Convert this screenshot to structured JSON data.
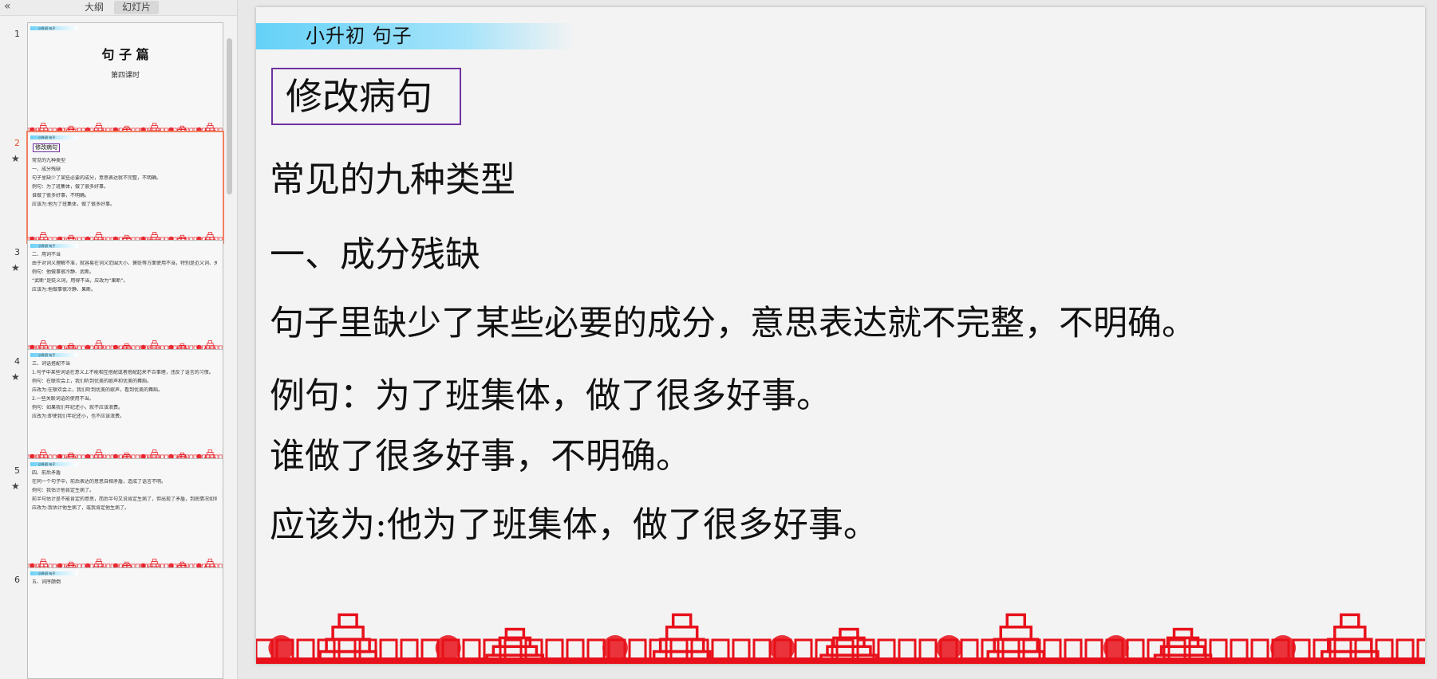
{
  "panel": {
    "collapse_glyph": "«",
    "tabs": [
      {
        "label": "大纲"
      },
      {
        "label": "幻灯片"
      }
    ]
  },
  "thumbnails": [
    {
      "number": "1",
      "header": "小升初 句子",
      "title": "句 子 篇",
      "subtitle": "第四课时",
      "lines": []
    },
    {
      "number": "2",
      "header": "小升初 句子",
      "box": "修改病句",
      "lines": [
        "常见的九种类型",
        "一、成分残缺",
        "句子里缺少了某些必要的成分，意思表达就不完整，不明确。",
        "例句：为了班集体，做了很多好事。",
        "谁做了很多好事，不明确。",
        "应该为:他为了班集体，做了很多好事。"
      ]
    },
    {
      "number": "3",
      "header": "小升初 句子",
      "lines": [
        "二、用词不当",
        "由于对词义理解不准，就容易在词义范围大小、褒贬等方面使用不当，特别是近义词、关联词用错，造成病句。",
        "例句：他做事很冷静、武断。",
        "“武断”是贬义词，用得不当，应改为“果断”。",
        "应该为:他做事很冷静、果断。"
      ]
    },
    {
      "number": "4",
      "header": "小升初 句子",
      "lines": [
        "三、词语搭配不当",
        "1.句子中某些词语在意义上不能相互搭配或者搭配起来不合事理，违反了语言的习惯。",
        "例句：在联欢会上，我们听到优美的歌声和优美的舞蹈。",
        "应改为:在联欢会上，我们听到优美的歌声，看到优美的舞蹈。",
        "2.一些关联词语的使用不当。",
        "例句：如果我们年纪还小，就不应该浪费。",
        "应改为:即使我们年纪还小，也不应该浪费。"
      ]
    },
    {
      "number": "5",
      "header": "小升初 句子",
      "lines": [
        "四、前后矛盾",
        "在同一个句子中，前后表达的意思自相矛盾，造成了语言不明。",
        "例句：我估计他肯定生病了。",
        "前半句估计是不能肯定的意思，而后半句又说肯定生病了，但出现了矛盾，到底情况如何呢？让人不清楚。",
        "应改为:我估计他生病了，或我肯定他生病了。"
      ]
    },
    {
      "number": "6",
      "header": "小升初 句子",
      "lines": [
        "五、词序颠倒"
      ]
    }
  ],
  "slide": {
    "header": "小升初  句子",
    "title_box": "修改病句",
    "lines": [
      "常见的九种类型",
      "一、成分残缺",
      "句子里缺少了某些必要的成分，意思表达就不完整，不明确。",
      "例句：为了班集体，做了很多好事。",
      "谁做了很多好事，不明确。",
      "应该为:他为了班集体，做了很多好事。"
    ]
  },
  "colors": {
    "header_bar": "#64d1f7",
    "title_border": "#7030a0",
    "border_ornament": "#e8101a",
    "selected_thumb": "#f08060"
  }
}
